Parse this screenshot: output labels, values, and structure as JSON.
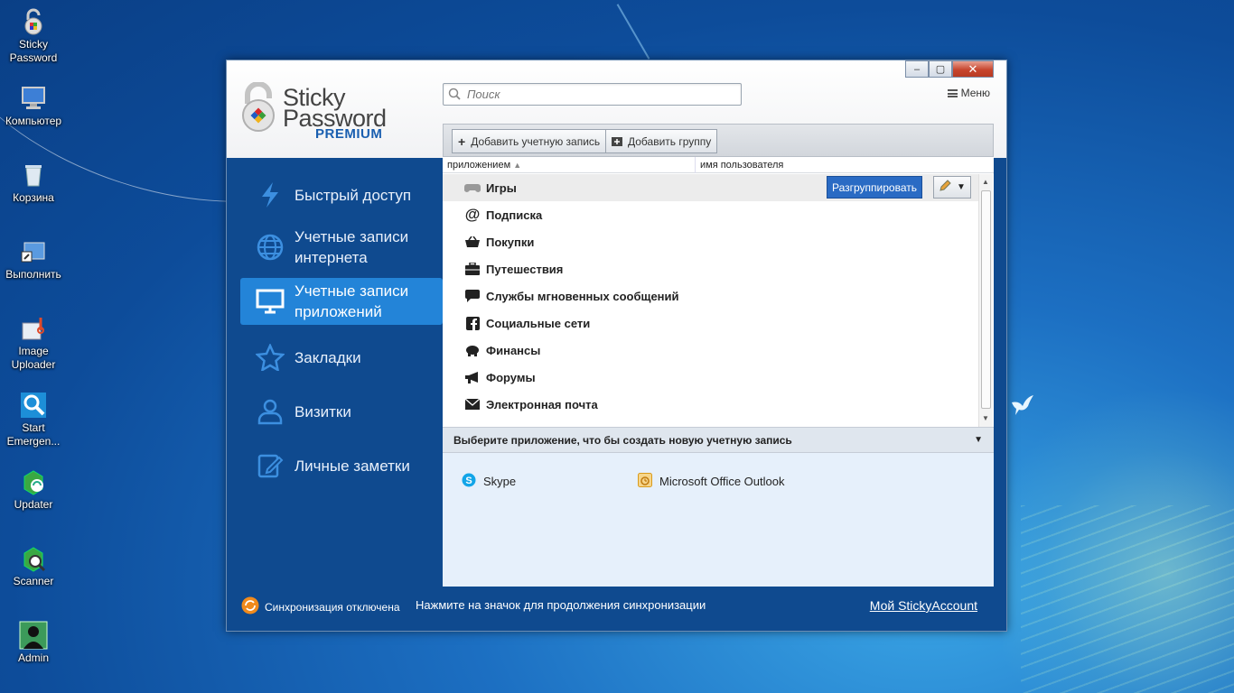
{
  "desktop": {
    "icons": [
      {
        "label": "Sticky Password",
        "icon": "sticky-password-icon"
      },
      {
        "label": "Компьютер",
        "icon": "computer-icon"
      },
      {
        "label": "Корзина",
        "icon": "recycle-bin-icon"
      },
      {
        "label": "Выполнить",
        "icon": "run-icon"
      },
      {
        "label": "Image Uploader",
        "icon": "image-uploader-icon"
      },
      {
        "label": "Start Emergen...",
        "icon": "emergency-icon"
      },
      {
        "label": "Updater",
        "icon": "updater-icon"
      },
      {
        "label": "Scanner",
        "icon": "scanner-icon"
      },
      {
        "label": "Admin",
        "icon": "admin-user-icon"
      }
    ]
  },
  "window": {
    "caption_buttons": {
      "minimize": "–",
      "maximize": "▢",
      "close": "✕"
    },
    "logo": {
      "line1": "Sticky",
      "line2": "Password",
      "line3": "PREMIUM"
    },
    "search": {
      "placeholder": "Поиск"
    },
    "menu_label": "Меню"
  },
  "sidebar": {
    "items": [
      {
        "label": "Быстрый доступ",
        "icon": "lightning-icon"
      },
      {
        "label": "Учетные записи интернета",
        "icon": "globe-icon"
      },
      {
        "label": "Учетные записи приложений",
        "icon": "monitor-icon",
        "active": true
      },
      {
        "label": "Закладки",
        "icon": "star-icon"
      },
      {
        "label": "Визитки",
        "icon": "person-icon"
      },
      {
        "label": "Личные заметки",
        "icon": "notes-icon"
      }
    ]
  },
  "toolbar": {
    "add_account": "Добавить учетную запись",
    "add_group": "Добавить группу"
  },
  "columns": {
    "app": "приложением",
    "user": "имя пользователя"
  },
  "groups": [
    {
      "label": "Игры",
      "icon": "gamepad-icon",
      "selected": true
    },
    {
      "label": "Подписка",
      "icon": "at-sign-icon"
    },
    {
      "label": "Покупки",
      "icon": "basket-icon"
    },
    {
      "label": "Путешествия",
      "icon": "suitcase-icon"
    },
    {
      "label": "Службы мгновенных сообщений",
      "icon": "chat-bubble-icon"
    },
    {
      "label": "Социальные сети",
      "icon": "facebook-icon"
    },
    {
      "label": "Финансы",
      "icon": "piggy-bank-icon"
    },
    {
      "label": "Форумы",
      "icon": "megaphone-icon"
    },
    {
      "label": "Электронная почта",
      "icon": "envelope-icon"
    }
  ],
  "row_actions": {
    "ungroup": "Разгруппировать"
  },
  "choose_app": {
    "label": "Выберите приложение, что бы создать новую учетную запись"
  },
  "apps": [
    {
      "label": "Skype",
      "icon": "skype-icon"
    },
    {
      "label": "Microsoft Office Outlook",
      "icon": "outlook-icon"
    }
  ],
  "status": {
    "sync": "Синхронизация отключена",
    "message": "Нажмите на значок для продолжения синхронизации",
    "account_link": "Мой StickyAccount"
  },
  "colors": {
    "window_bg": "#0f4a8f",
    "active_item": "#2384d8",
    "ungroup_button": "#2a6bc4",
    "logo_accent": "#1a5fb0"
  }
}
